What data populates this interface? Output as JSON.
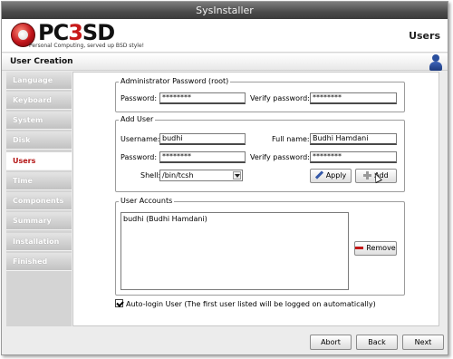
{
  "window": {
    "title": "SysInstaller"
  },
  "banner": {
    "logo_text": "PC-BSD",
    "logo_display": [
      "PC",
      "3",
      "SD"
    ],
    "tagline": "Personal Computing, served up BSD style!",
    "page_title": "Users"
  },
  "section": {
    "title": "User Creation",
    "icon": "user-icon"
  },
  "sidebar": {
    "items": [
      {
        "label": "Language",
        "active": false
      },
      {
        "label": "Keyboard",
        "active": false
      },
      {
        "label": "System",
        "active": false
      },
      {
        "label": "Disk",
        "active": false
      },
      {
        "label": "Users",
        "active": true
      },
      {
        "label": "Time",
        "active": false
      },
      {
        "label": "Components",
        "active": false
      },
      {
        "label": "Summary",
        "active": false
      },
      {
        "label": "Installation",
        "active": false
      },
      {
        "label": "Finished",
        "active": false
      }
    ]
  },
  "admin": {
    "title": "Administrator Password (root)",
    "password_label": "Password:",
    "password_value": "********",
    "verify_label": "Verify password:",
    "verify_value": "********"
  },
  "add_user": {
    "title": "Add User",
    "username_label": "Username:",
    "username_value": "budhi",
    "fullname_label": "Full name:",
    "fullname_value": "Budhi Hamdani",
    "password_label": "Password:",
    "password_value": "********",
    "verify_label": "Verify password:",
    "verify_value": "********",
    "shell_label": "Shell:",
    "shell_value": "/bin/tcsh",
    "apply_label": "Apply",
    "add_label": "Add"
  },
  "accounts": {
    "title": "User Accounts",
    "items": [
      "budhi (Budhi Hamdani)"
    ],
    "remove_label": "Remove"
  },
  "autologin": {
    "checked": true,
    "label": "Auto-login User (The first user listed will be logged on automatically)"
  },
  "footer": {
    "abort_label": "Abort",
    "back_label": "Back",
    "next_label": "Next"
  },
  "colors": {
    "active_nav": "#b41515",
    "title_bar": "#4a4a4a",
    "brand_red": "#c71a1a"
  }
}
